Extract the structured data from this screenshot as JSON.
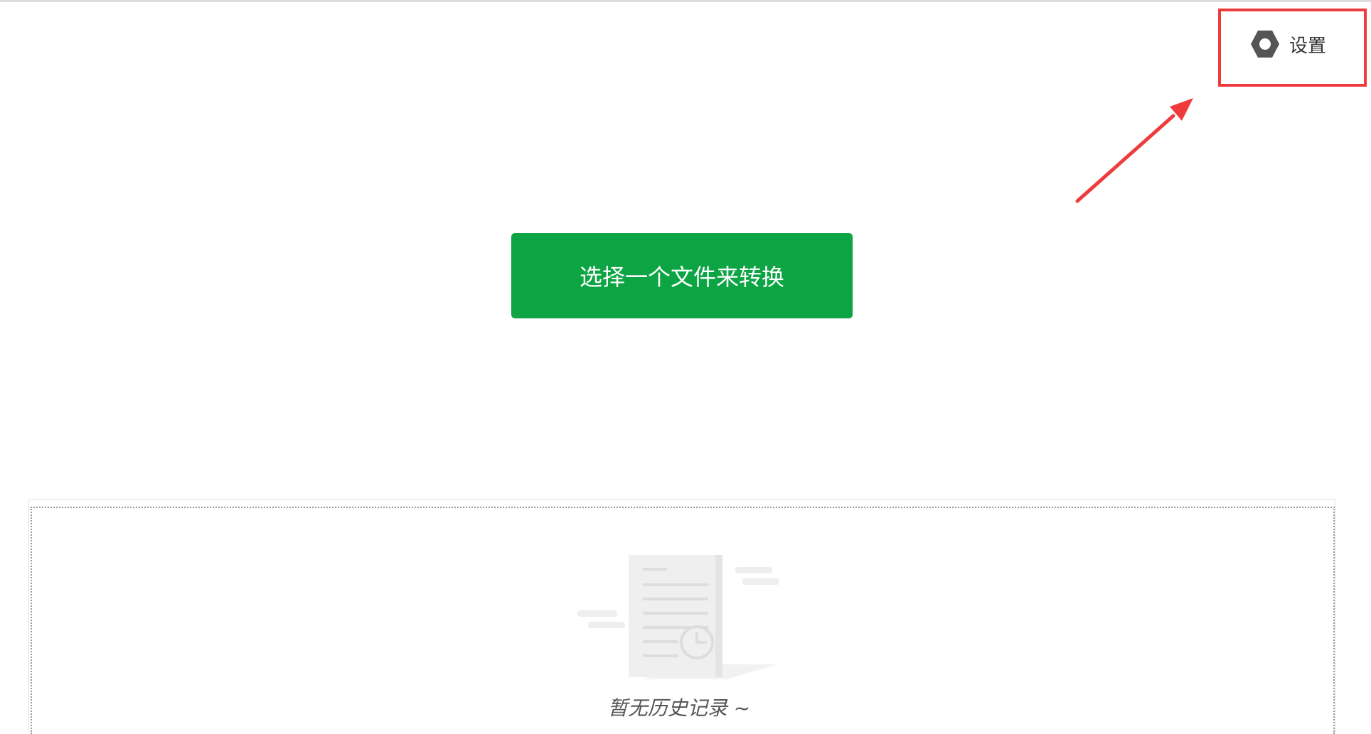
{
  "header": {
    "settings": {
      "label": "设置",
      "icon": "gear-icon"
    }
  },
  "main": {
    "convert_button_label": "选择一个文件来转换"
  },
  "history": {
    "empty_message": "暂无历史记录 ~",
    "illustration_icon": "empty-document-clock-icon"
  },
  "colors": {
    "primary": "#0da444",
    "annotation": "#ef3b3b",
    "icon": "#555555",
    "text": "#333333"
  }
}
